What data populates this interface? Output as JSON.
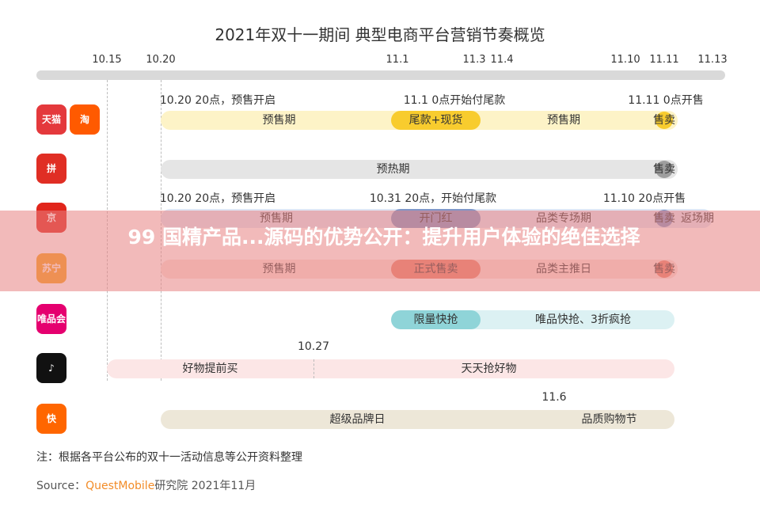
{
  "chart_data": {
    "type": "timeline",
    "title": "2021年双十一期间 典型电商平台营销节奏概览",
    "dates": [
      "10.15",
      "10.20",
      "11.1",
      "11.3",
      "11.4",
      "11.10",
      "11.11",
      "11.13"
    ],
    "rows": [
      {
        "logos": [
          "天猫",
          "淘"
        ],
        "annotations": [
          {
            "text": "10.20 20点，预售开启",
            "at": "10.20"
          },
          {
            "text": "11.1 0点开始付尾款",
            "at": "11.1"
          },
          {
            "text": "11.11 0点开售",
            "at": "11.11"
          }
        ],
        "segments": [
          {
            "label": "预售期",
            "start": "10.20",
            "end": "11.1"
          },
          {
            "label": "尾款+现货",
            "start": "11.1",
            "end": "11.3"
          },
          {
            "label": "预售期",
            "start": "11.4",
            "end": "11.10"
          },
          {
            "label": "售卖",
            "start": "11.11",
            "end": "11.11"
          }
        ],
        "color": "#fdf3c7",
        "accent": "#f8cc2e"
      },
      {
        "logos": [
          "拼"
        ],
        "annotations": [],
        "segments": [
          {
            "label": "预热期",
            "start": "10.20",
            "end": "11.10"
          },
          {
            "label": "售卖",
            "start": "11.11",
            "end": "11.11"
          }
        ],
        "color": "#e5e5e5",
        "accent": "#9e9e9e"
      },
      {
        "logos": [
          "京"
        ],
        "annotations": [
          {
            "text": "10.20 20点，预售开启",
            "at": "10.20"
          },
          {
            "text": "10.31 20点，开始付尾款",
            "at": "10.31"
          },
          {
            "text": "11.10 20点开售",
            "at": "11.10"
          }
        ],
        "segments": [
          {
            "label": "预售期",
            "start": "10.20",
            "end": "10.31"
          },
          {
            "label": "开门红",
            "start": "11.1",
            "end": "11.3"
          },
          {
            "label": "品类专场期",
            "start": "11.4",
            "end": "11.10"
          },
          {
            "label": "售卖",
            "start": "11.11",
            "end": "11.11"
          },
          {
            "label": "返场期",
            "start": "11.12",
            "end": "11.13"
          }
        ],
        "color": "#dfe7f5",
        "accent": "#7f97c8"
      },
      {
        "logos": [
          "苏宁"
        ],
        "annotations": [],
        "segments": [
          {
            "label": "预售期",
            "start": "10.20",
            "end": "11.1"
          },
          {
            "label": "正式售卖",
            "start": "11.1",
            "end": "11.3"
          },
          {
            "label": "品类主推日",
            "start": "11.4",
            "end": "11.10"
          },
          {
            "label": "售卖",
            "start": "11.11",
            "end": "11.11"
          }
        ],
        "color": "#fbe3dc",
        "accent": "#e9836e"
      },
      {
        "logos": [
          "唯品会"
        ],
        "annotations": [],
        "segments": [
          {
            "label": "限量快抢",
            "start": "11.1",
            "end": "11.3"
          },
          {
            "label": "唯品快抢、3折疯抢",
            "start": "11.4",
            "end": "11.11"
          }
        ],
        "color": "#dcf1f3",
        "accent": "#8fd4d8"
      },
      {
        "logos": [
          "♪"
        ],
        "annotations": [
          {
            "text": "10.27",
            "at": "10.27"
          }
        ],
        "segments": [
          {
            "label": "好物提前买",
            "start": "10.15",
            "end": "10.27"
          },
          {
            "label": "天天抢好物",
            "start": "10.27",
            "end": "11.11"
          }
        ],
        "color": "#fce6e6",
        "accent": "#f4b9b9"
      },
      {
        "logos": [
          "快"
        ],
        "annotations": [
          {
            "text": "11.6",
            "at": "11.6"
          }
        ],
        "segments": [
          {
            "label": "超级品牌日",
            "start": "10.20",
            "end": "11.6"
          },
          {
            "label": "品质购物节",
            "start": "11.6",
            "end": "11.11"
          }
        ],
        "color": "#ede7d8",
        "accent": "#d6c8a8"
      }
    ]
  },
  "note": "注：根据各平台公布的双十一活动信息等公开资料整理",
  "source": {
    "prefix": "Source：",
    "brand": "QuestMobile",
    "suffix": "研究院 2021年11月"
  },
  "overlay": {
    "text": "99 国精产品...源码的优势公开：提升用户体验的绝佳选择"
  }
}
